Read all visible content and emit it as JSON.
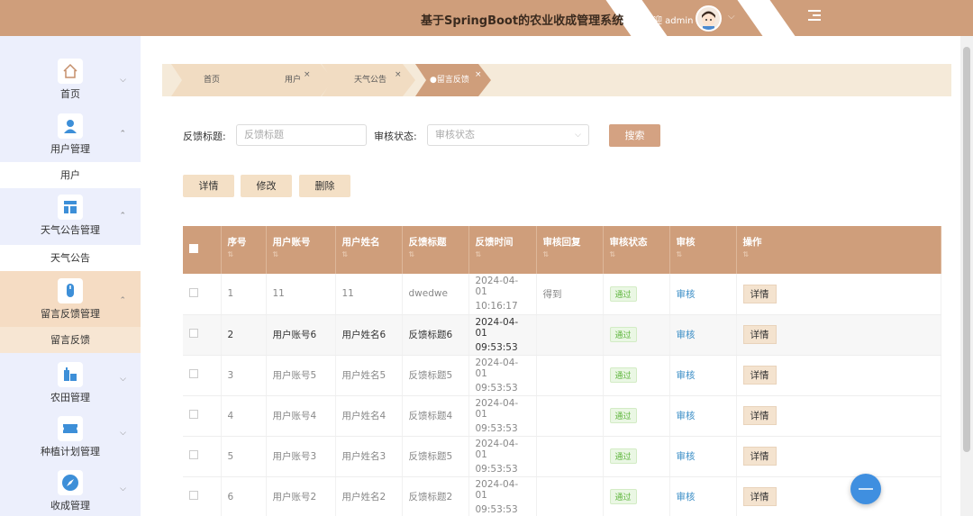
{
  "header": {
    "title": "基于SpringBoot的农业收成管理系统",
    "welcome": "欢迎 admin"
  },
  "sidebar": {
    "items": [
      {
        "label": "首页",
        "icon": "home-icon",
        "expanded": false,
        "sub": []
      },
      {
        "label": "用户管理",
        "icon": "user-icon",
        "expanded": true,
        "sub": [
          "用户"
        ]
      },
      {
        "label": "天气公告管理",
        "icon": "layout-icon",
        "expanded": true,
        "sub": [
          "天气公告"
        ]
      },
      {
        "label": "留言反馈管理",
        "icon": "mouse-icon",
        "expanded": true,
        "sub": [
          "留言反馈"
        ]
      },
      {
        "label": "农田管理",
        "icon": "building-icon",
        "expanded": false,
        "sub": []
      },
      {
        "label": "种植计划管理",
        "icon": "ticket-icon",
        "expanded": false,
        "sub": []
      },
      {
        "label": "收成管理",
        "icon": "compass-icon",
        "expanded": false,
        "sub": []
      }
    ]
  },
  "tabs": [
    {
      "label": "首页",
      "closable": false
    },
    {
      "label": "用户",
      "closable": true
    },
    {
      "label": "天气公告",
      "closable": true
    },
    {
      "label": "●留言反馈",
      "closable": true
    }
  ],
  "search": {
    "title_label": "反馈标题:",
    "title_placeholder": "反馈标题",
    "status_label": "审核状态:",
    "status_placeholder": "审核状态",
    "button": "搜索"
  },
  "actions": {
    "detail": "详情",
    "edit": "修改",
    "delete": "删除"
  },
  "table": {
    "columns": [
      "序号",
      "用户账号",
      "用户姓名",
      "反馈标题",
      "反馈时间",
      "审核回复",
      "审核状态",
      "审核",
      "操作"
    ],
    "rows": [
      {
        "no": "1",
        "account": "11",
        "name": "11",
        "title": "dwedwe",
        "date": "2024-04-01",
        "time": "10:16:17",
        "reply": "得到",
        "status": "通过",
        "audit": "审核",
        "op": "详情"
      },
      {
        "no": "2",
        "account": "用户账号6",
        "name": "用户姓名6",
        "title": "反馈标题6",
        "date": "2024-04-01",
        "time": "09:53:53",
        "reply": "",
        "status": "通过",
        "audit": "审核",
        "op": "详情"
      },
      {
        "no": "3",
        "account": "用户账号5",
        "name": "用户姓名5",
        "title": "反馈标题5",
        "date": "2024-04-01",
        "time": "09:53:53",
        "reply": "",
        "status": "通过",
        "audit": "审核",
        "op": "详情"
      },
      {
        "no": "4",
        "account": "用户账号4",
        "name": "用户姓名4",
        "title": "反馈标题4",
        "date": "2024-04-01",
        "time": "09:53:53",
        "reply": "",
        "status": "通过",
        "audit": "审核",
        "op": "详情"
      },
      {
        "no": "5",
        "account": "用户账号3",
        "name": "用户姓名3",
        "title": "反馈标题5",
        "date": "2024-04-01",
        "time": "09:53:53",
        "reply": "",
        "status": "通过",
        "audit": "审核",
        "op": "详情"
      },
      {
        "no": "6",
        "account": "用户账号2",
        "name": "用户姓名2",
        "title": "反馈标题2",
        "date": "2024-04-01",
        "time": "09:53:53",
        "reply": "",
        "status": "通过",
        "audit": "审核",
        "op": "详情"
      }
    ]
  },
  "colors": {
    "accent": "#cf9e7b",
    "sidebar_bg": "#eceffc",
    "link": "#3d8fc7",
    "success": "#5db53c"
  }
}
